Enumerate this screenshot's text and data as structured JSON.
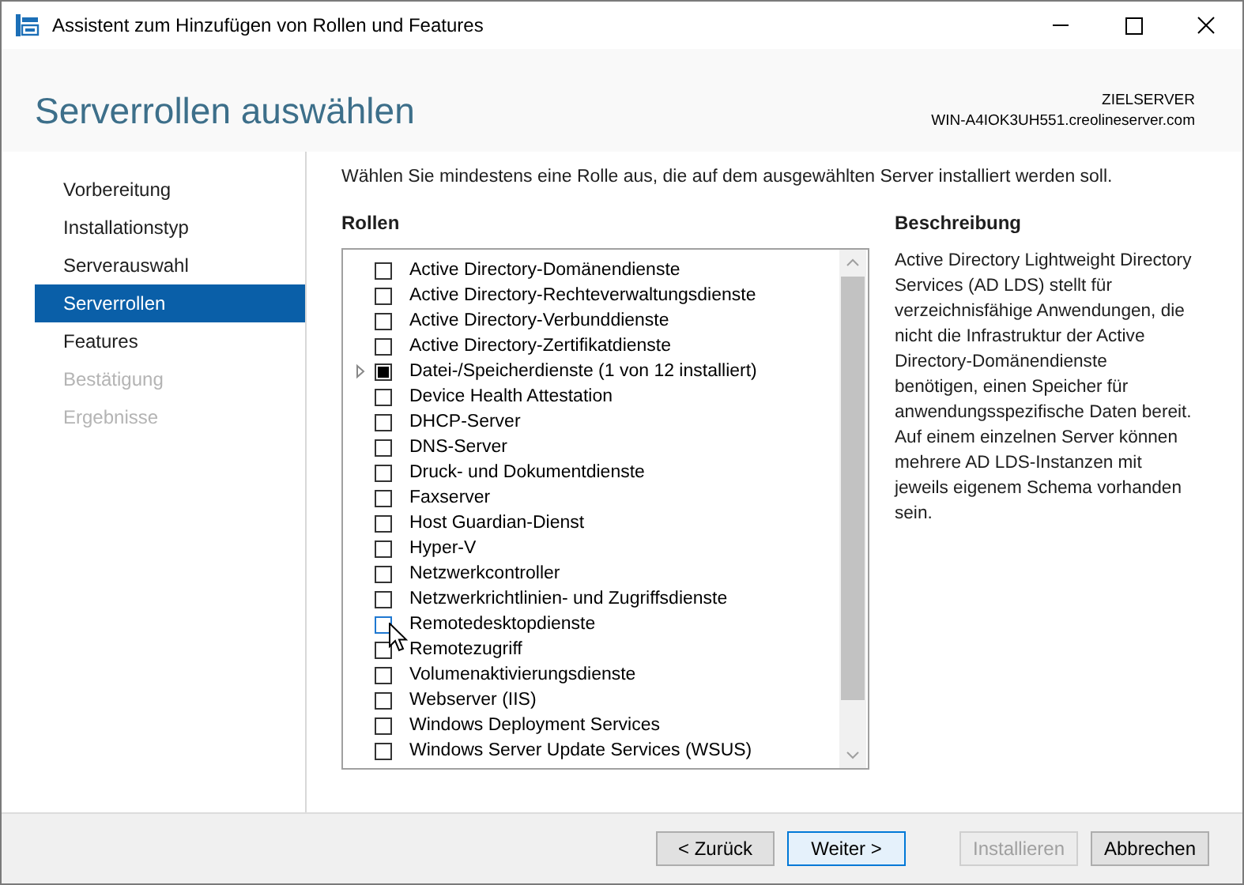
{
  "window": {
    "title": "Assistent zum Hinzufügen von Rollen und Features"
  },
  "header": {
    "title": "Serverrollen auswählen",
    "target_label": "ZIELSERVER",
    "target_server": "WIN-A4IOK3UH551.creolineserver.com"
  },
  "steps": [
    {
      "label": "Vorbereitung",
      "selected": false,
      "disabled": false
    },
    {
      "label": "Installationstyp",
      "selected": false,
      "disabled": false
    },
    {
      "label": "Serverauswahl",
      "selected": false,
      "disabled": false
    },
    {
      "label": "Serverrollen",
      "selected": true,
      "disabled": false
    },
    {
      "label": "Features",
      "selected": false,
      "disabled": false
    },
    {
      "label": "Bestätigung",
      "selected": false,
      "disabled": true
    },
    {
      "label": "Ergebnisse",
      "selected": false,
      "disabled": true
    }
  ],
  "instruction": "Wählen Sie mindestens eine Rolle aus, die auf dem ausgewählten Server installiert werden soll.",
  "roles_heading": "Rollen",
  "roles": [
    {
      "label": "Active Directory-Domänendienste",
      "checked": false,
      "indeterminate": false,
      "expandable": false,
      "hovered": false
    },
    {
      "label": "Active Directory-Rechteverwaltungsdienste",
      "checked": false,
      "indeterminate": false,
      "expandable": false,
      "hovered": false
    },
    {
      "label": "Active Directory-Verbunddienste",
      "checked": false,
      "indeterminate": false,
      "expandable": false,
      "hovered": false
    },
    {
      "label": "Active Directory-Zertifikatdienste",
      "checked": false,
      "indeterminate": false,
      "expandable": false,
      "hovered": false
    },
    {
      "label": "Datei-/Speicherdienste (1 von 12 installiert)",
      "checked": false,
      "indeterminate": true,
      "expandable": true,
      "hovered": false
    },
    {
      "label": "Device Health Attestation",
      "checked": false,
      "indeterminate": false,
      "expandable": false,
      "hovered": false
    },
    {
      "label": "DHCP-Server",
      "checked": false,
      "indeterminate": false,
      "expandable": false,
      "hovered": false
    },
    {
      "label": "DNS-Server",
      "checked": false,
      "indeterminate": false,
      "expandable": false,
      "hovered": false
    },
    {
      "label": "Druck- und Dokumentdienste",
      "checked": false,
      "indeterminate": false,
      "expandable": false,
      "hovered": false
    },
    {
      "label": "Faxserver",
      "checked": false,
      "indeterminate": false,
      "expandable": false,
      "hovered": false
    },
    {
      "label": "Host Guardian-Dienst",
      "checked": false,
      "indeterminate": false,
      "expandable": false,
      "hovered": false
    },
    {
      "label": "Hyper-V",
      "checked": false,
      "indeterminate": false,
      "expandable": false,
      "hovered": false
    },
    {
      "label": "Netzwerkcontroller",
      "checked": false,
      "indeterminate": false,
      "expandable": false,
      "hovered": false
    },
    {
      "label": "Netzwerkrichtlinien- und Zugriffsdienste",
      "checked": false,
      "indeterminate": false,
      "expandable": false,
      "hovered": false
    },
    {
      "label": "Remotedesktopdienste",
      "checked": false,
      "indeterminate": false,
      "expandable": false,
      "hovered": true
    },
    {
      "label": "Remotezugriff",
      "checked": false,
      "indeterminate": false,
      "expandable": false,
      "hovered": false
    },
    {
      "label": "Volumenaktivierungsdienste",
      "checked": false,
      "indeterminate": false,
      "expandable": false,
      "hovered": false
    },
    {
      "label": "Webserver (IIS)",
      "checked": false,
      "indeterminate": false,
      "expandable": false,
      "hovered": false
    },
    {
      "label": "Windows Deployment Services",
      "checked": false,
      "indeterminate": false,
      "expandable": false,
      "hovered": false
    },
    {
      "label": "Windows Server Update Services (WSUS)",
      "checked": false,
      "indeterminate": false,
      "expandable": false,
      "hovered": false
    }
  ],
  "description": {
    "heading": "Beschreibung",
    "text": "Active Directory Lightweight Directory Services (AD LDS) stellt für verzeichnisfähige Anwendungen, die nicht die Infrastruktur der Active Directory-Domänendienste benötigen, einen Speicher für anwendungsspezifische Daten bereit. Auf einem einzelnen Server können mehrere AD LDS-Instanzen mit jeweils eigenem Schema vorhanden sein."
  },
  "buttons": [
    {
      "label": "< Zurück",
      "default": false,
      "disabled": false
    },
    {
      "label": "Weiter >",
      "default": true,
      "disabled": false
    },
    {
      "label": "Installieren",
      "default": false,
      "disabled": true
    },
    {
      "label": "Abbrechen",
      "default": false,
      "disabled": false
    }
  ]
}
